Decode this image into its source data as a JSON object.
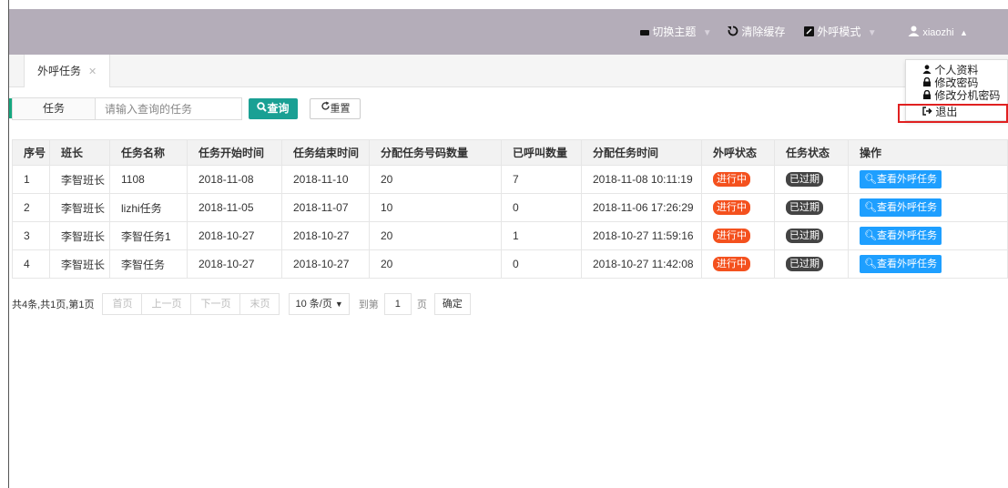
{
  "topbar": {
    "theme_label": "切换主题",
    "clear_cache_label": "清除缓存",
    "call_mode_label": "外呼模式",
    "username": "xiaozhi"
  },
  "tabs": [
    {
      "label": "外呼任务"
    }
  ],
  "search": {
    "label": "任务",
    "placeholder": "请输入查询的任务",
    "query_label": "查询",
    "reset_label": "重置"
  },
  "user_menu": {
    "items": [
      "个人资料",
      "修改密码",
      "修改分机密码",
      "退出"
    ]
  },
  "table": {
    "headers": [
      "序号",
      "班长",
      "任务名称",
      "任务开始时间",
      "任务结束时间",
      "分配任务号码数量",
      "已呼叫数量",
      "分配任务时间",
      "外呼状态",
      "任务状态",
      "操作"
    ],
    "rows": [
      [
        "1",
        "李智班长",
        "1108",
        "2018-11-08",
        "2018-11-10",
        "20",
        "7",
        "2018-11-08 10:11:19",
        "进行中",
        "已过期",
        "查看外呼任务"
      ],
      [
        "2",
        "李智班长",
        "lizhi任务",
        "2018-11-05",
        "2018-11-07",
        "10",
        "0",
        "2018-11-06 17:26:29",
        "进行中",
        "已过期",
        "查看外呼任务"
      ],
      [
        "3",
        "李智班长",
        "李智任务1",
        "2018-10-27",
        "2018-10-27",
        "20",
        "1",
        "2018-10-27 11:59:16",
        "进行中",
        "已过期",
        "查看外呼任务"
      ],
      [
        "4",
        "李智班长",
        "李智任务",
        "2018-10-27",
        "2018-10-27",
        "20",
        "0",
        "2018-10-27 11:42:08",
        "进行中",
        "已过期",
        "查看外呼任务"
      ]
    ]
  },
  "pager": {
    "info": "共4条,共1页,第1页",
    "first": "首页",
    "prev": "上一页",
    "next": "下一页",
    "last": "末页",
    "page_size": "10 条/页",
    "goto_label": "到第",
    "page_value": "1",
    "page_unit": "页",
    "confirm": "确定"
  },
  "colors": {
    "topbar": "#b4adb9",
    "accent_green": "#1aa094",
    "status_red": "#f4511e",
    "status_dark": "#444444",
    "view_blue": "#1e9fff"
  }
}
